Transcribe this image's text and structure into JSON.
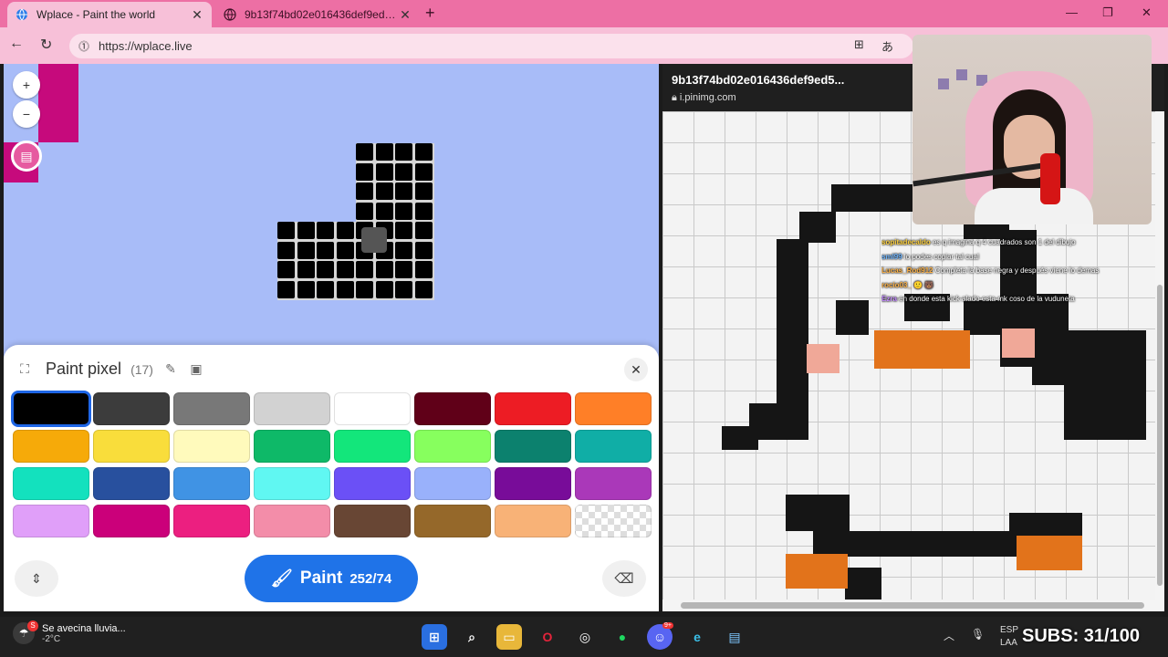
{
  "browser": {
    "tabs": [
      {
        "title": "Wplace - Paint the world",
        "active": true
      },
      {
        "title": "9b13f74bd02e016436def9ed581…",
        "active": false
      }
    ],
    "url": "https://wplace.live",
    "translate_label": "あ"
  },
  "paint_panel": {
    "title": "Paint pixel",
    "count": "(17)",
    "paint_label": "Paint",
    "charges": "252/74",
    "palette": [
      "#000000",
      "#3c3c3c",
      "#787878",
      "#d2d2d2",
      "#ffffff",
      "#600018",
      "#ed1c24",
      "#ff7f27",
      "#f6aa09",
      "#f9dd3b",
      "#fffabc",
      "#0eb968",
      "#13e67b",
      "#87ff5e",
      "#0c816e",
      "#10aea6",
      "#13e1be",
      "#28509e",
      "#4093e4",
      "#60f7f2",
      "#6b50f6",
      "#99b1fb",
      "#780c99",
      "#aa38b9",
      "#e09ff9",
      "#cb007a",
      "#ec1f80",
      "#f38da9",
      "#684634",
      "#95682a",
      "#f8b277",
      "transparent"
    ],
    "selected_index": 0
  },
  "viewer": {
    "title": "9b13f74bd02e016436def9ed5...",
    "source": "i.pinimg.com"
  },
  "chat": [
    {
      "user": "sopitadecaldo",
      "color": "#ffd23f",
      "msg": "es q imagina q 4 cuadrados son 1 del dibujo"
    },
    {
      "user": "sml99",
      "color": "#6fb6ff",
      "msg": "lo podes copiar tal cual"
    },
    {
      "user": "Lucas_Rod912",
      "color": "#ffb347",
      "msg": "Completa la base negra y después viene lo demas"
    },
    {
      "user": "rocio03_",
      "color": "#ffb347",
      "msg": "🙂 🐻"
    },
    {
      "user": "Ezra",
      "color": "#c58cff",
      "msg": "en donde esta kick alado esta mk coso de la vuduneta"
    }
  ],
  "taskbar": {
    "weather_title": "Se avecina lluvia...",
    "weather_temp": "-2°C",
    "weather_badge": "S",
    "lang_1": "ESP",
    "lang_2": "LAA",
    "subs": "SUBS: 31/100",
    "discord_badge": "9+"
  },
  "colors": {
    "accent": "#1f73e8",
    "tab_strip": "#ed6fa4",
    "map_bg": "#a8bcf8"
  }
}
